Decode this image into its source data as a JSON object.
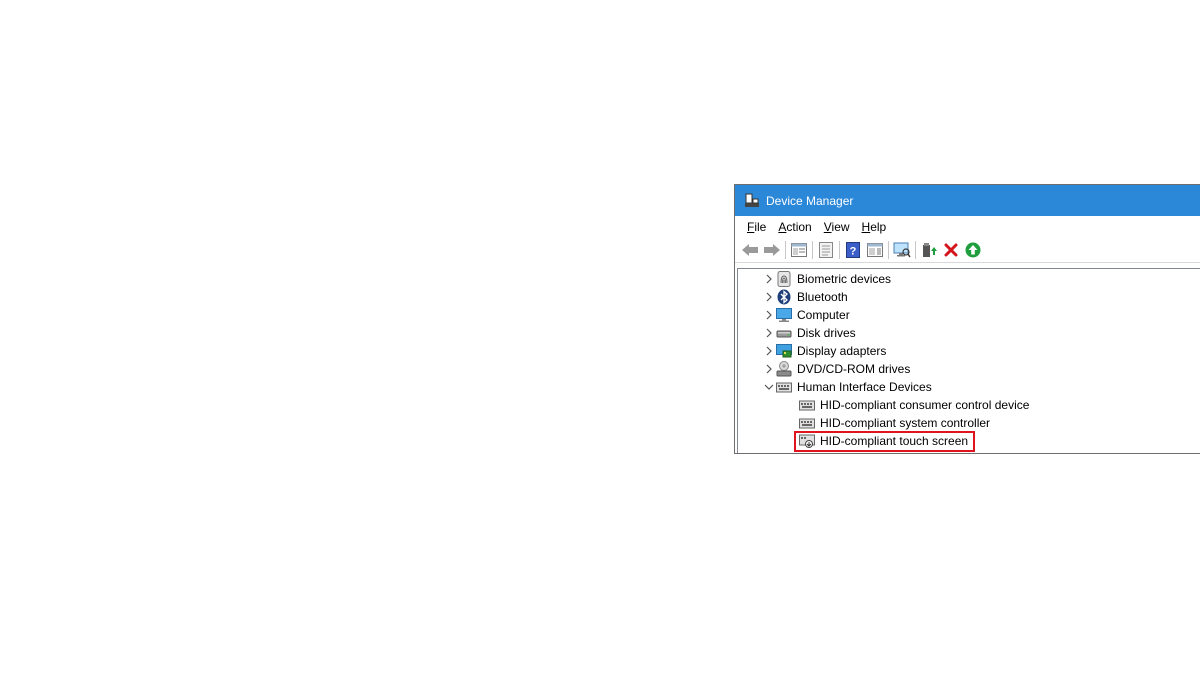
{
  "window": {
    "title": "Device Manager"
  },
  "menubar": {
    "items": [
      {
        "access_key": "F",
        "rest": "ile"
      },
      {
        "access_key": "A",
        "rest": "ction"
      },
      {
        "access_key": "V",
        "rest": "iew"
      },
      {
        "access_key": "H",
        "rest": "elp"
      }
    ]
  },
  "toolbar": {
    "buttons": [
      "back-arrow-icon",
      "forward-arrow-icon",
      "show-hide-console-tree-icon",
      "properties-icon",
      "help-icon",
      "action-pane-icon",
      "scan-hardware-icon",
      "update-driver-icon",
      "uninstall-icon",
      "enable-device-icon"
    ]
  },
  "tree": {
    "categories": [
      {
        "label": "Biometric devices",
        "icon": "fingerprint-icon",
        "expanded": false
      },
      {
        "label": "Bluetooth",
        "icon": "bluetooth-icon",
        "expanded": false
      },
      {
        "label": "Computer",
        "icon": "computer-icon",
        "expanded": false
      },
      {
        "label": "Disk drives",
        "icon": "disk-drive-icon",
        "expanded": false
      },
      {
        "label": "Display adapters",
        "icon": "display-adapter-icon",
        "expanded": false
      },
      {
        "label": "DVD/CD-ROM drives",
        "icon": "dvd-drive-icon",
        "expanded": false
      },
      {
        "label": "Human Interface Devices",
        "icon": "hid-icon",
        "expanded": true
      }
    ],
    "hid_children": [
      {
        "label": "HID-compliant consumer control device",
        "icon": "hid-device-icon"
      },
      {
        "label": "HID-compliant system controller",
        "icon": "hid-device-icon"
      },
      {
        "label": "HID-compliant touch screen",
        "icon": "touch-screen-icon",
        "highlighted": true
      }
    ]
  },
  "colors": {
    "titlebar": "#2b88d8",
    "highlight_border": "#e0141e",
    "uninstall": "#d4161c",
    "enable": "#1e9e3e"
  }
}
